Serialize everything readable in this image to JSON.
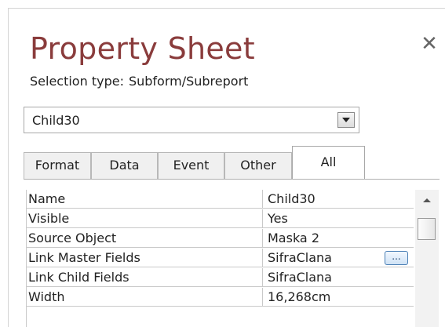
{
  "title": "Property Sheet",
  "close_icon": "close-icon",
  "selection": {
    "label": "Selection type:",
    "value": "Subform/Subreport"
  },
  "object_combo": {
    "value": "Child30"
  },
  "tabs": [
    {
      "label": "Format",
      "active": false
    },
    {
      "label": "Data",
      "active": false
    },
    {
      "label": "Event",
      "active": false
    },
    {
      "label": "Other",
      "active": false
    },
    {
      "label": "All",
      "active": true
    }
  ],
  "properties": [
    {
      "name": "Name",
      "value": "Child30"
    },
    {
      "name": "Visible",
      "value": "Yes"
    },
    {
      "name": "Source Object",
      "value": "Maska 2"
    },
    {
      "name": "Link Master Fields",
      "value": "SifraClana",
      "builder": "..."
    },
    {
      "name": "Link Child Fields",
      "value": "SifraClana"
    },
    {
      "name": "Width",
      "value": "16,268cm"
    }
  ],
  "colors": {
    "title": "#8a3c3c",
    "accent": "#4a7fb5"
  }
}
